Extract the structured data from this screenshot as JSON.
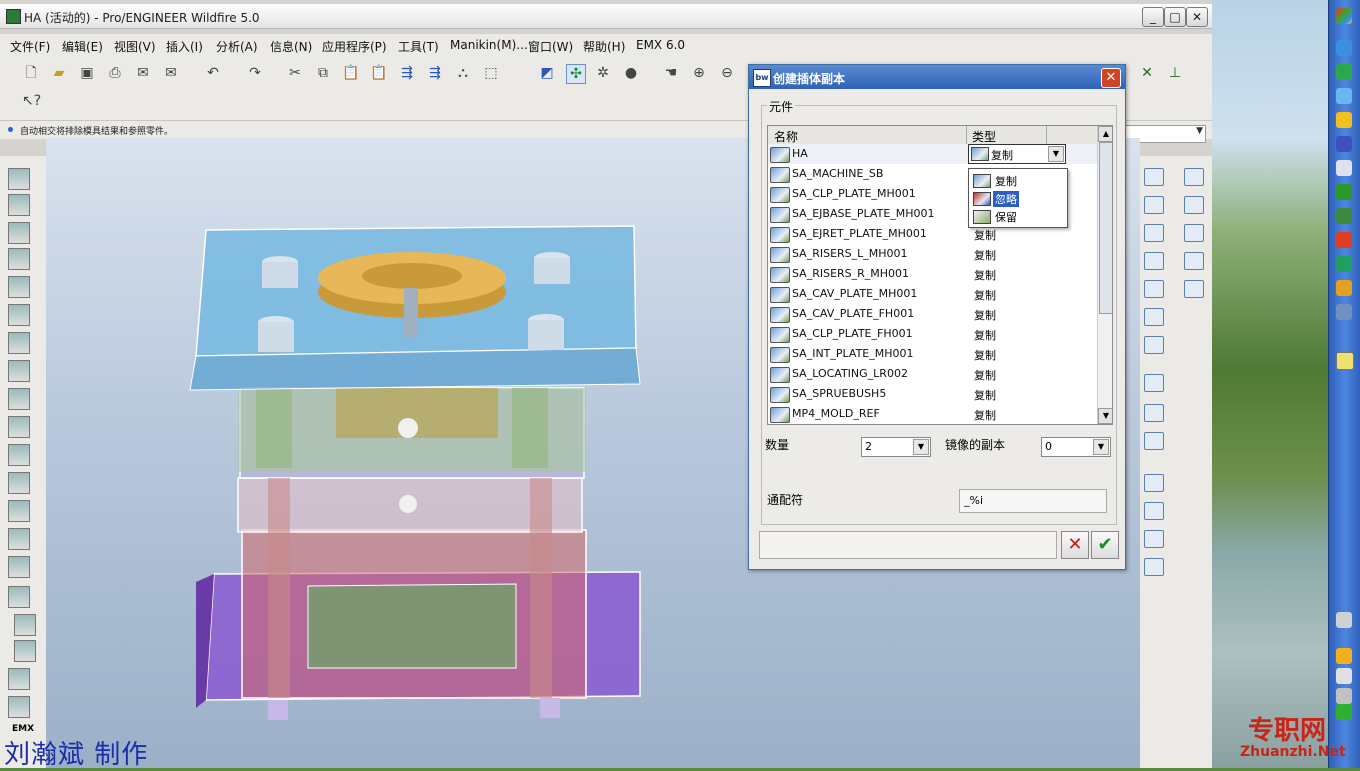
{
  "window": {
    "title": "HA (活动的) - Pro/ENGINEER Wildfire 5.0"
  },
  "menu": [
    "文件(F)",
    "编辑(E)",
    "视图(V)",
    "插入(I)",
    "分析(A)",
    "信息(N)",
    "应用程序(P)",
    "工具(T)",
    "Manikin(M)...",
    "窗口(W)",
    "帮助(H)",
    "EMX 6.0"
  ],
  "message": "自动相交将排除模具结果和参照零件。",
  "left_toolbar_label": "EMX",
  "dialog": {
    "title": "创建插体副本",
    "group_label": "元件",
    "columns": {
      "name": "名称",
      "type": "类型"
    },
    "rows": [
      {
        "name": "HA",
        "type": "复制"
      },
      {
        "name": "SA_MACHINE_SB",
        "type": ""
      },
      {
        "name": "SA_CLP_PLATE_MH001",
        "type": ""
      },
      {
        "name": "SA_EJBASE_PLATE_MH001",
        "type": ""
      },
      {
        "name": "SA_EJRET_PLATE_MH001",
        "type": "复制"
      },
      {
        "name": "SA_RISERS_L_MH001",
        "type": "复制"
      },
      {
        "name": "SA_RISERS_R_MH001",
        "type": "复制"
      },
      {
        "name": "SA_CAV_PLATE_MH001",
        "type": "复制"
      },
      {
        "name": "SA_CAV_PLATE_FH001",
        "type": "复制"
      },
      {
        "name": "SA_CLP_PLATE_FH001",
        "type": "复制"
      },
      {
        "name": "SA_INT_PLATE_MH001",
        "type": "复制"
      },
      {
        "name": "SA_LOCATING_LR002",
        "type": "复制"
      },
      {
        "name": "SA_SPRUEBUSH5",
        "type": "复制"
      },
      {
        "name": "MP4_MOLD_REF",
        "type": "复制"
      }
    ],
    "type_dropdown": {
      "selected": "复制",
      "options": [
        "复制",
        "忽略",
        "保留"
      ],
      "highlighted": "忽略"
    },
    "quantity": {
      "label": "数量",
      "value": "2"
    },
    "mirror": {
      "label": "镜像的副本",
      "value": "0"
    },
    "wildcard": {
      "label": "通配符",
      "value": "_%i"
    }
  },
  "watermark": {
    "credit": "刘瀚斌 制作",
    "brand": "专职网",
    "url": "Zhuanzhi.Net"
  },
  "colors": {
    "dialog_title": "#2d62b8",
    "highlight": "#2b5fc7",
    "cancel": "#d01818",
    "ok": "#1c8a1c"
  }
}
